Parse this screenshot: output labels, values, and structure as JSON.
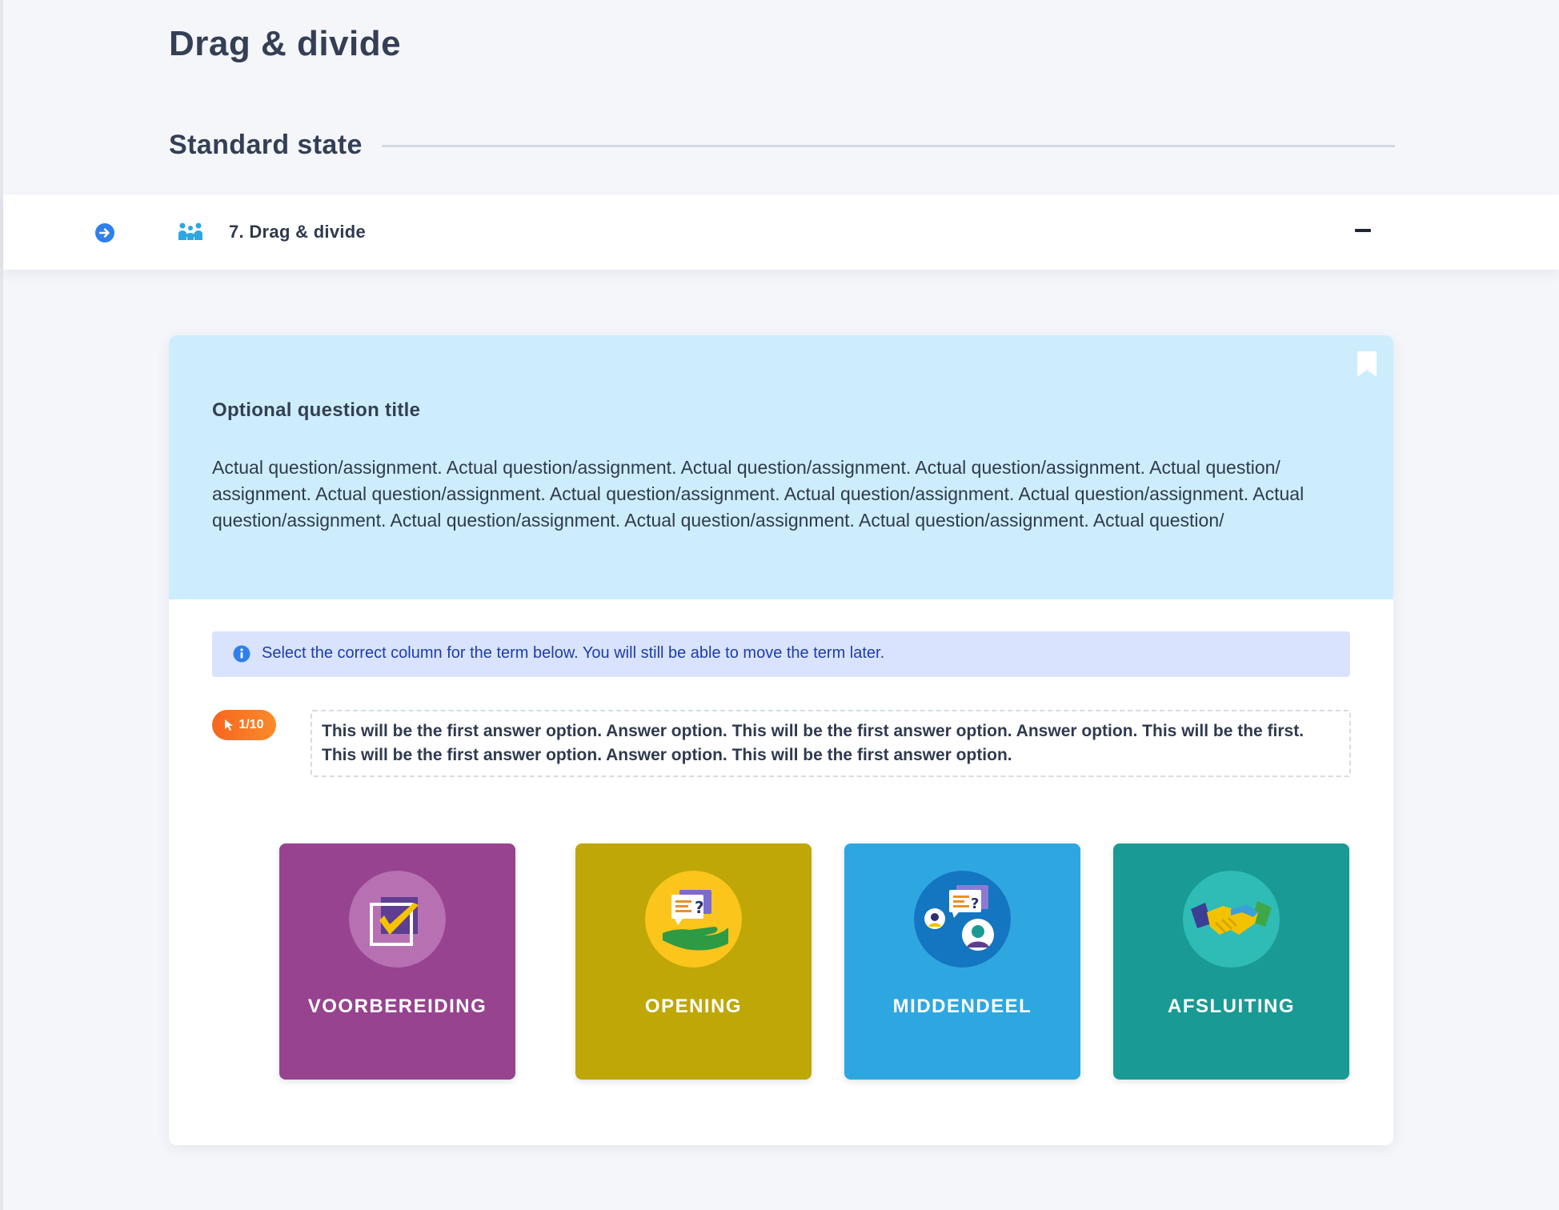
{
  "page": {
    "title": "Drag & divide",
    "section_heading": "Standard state"
  },
  "accordion": {
    "title": "7. Drag & divide",
    "arrow_icon": "arrow-right-circle-icon",
    "type_icon": "people-group-icon",
    "collapse_icon": "minus-icon"
  },
  "question": {
    "title": "Optional question title",
    "body": "Actual question/assignment. Actual question/assignment. Actual question/assignment. Actual question/assignment. Actual question/ assignment. Actual question/assignment. Actual question/assignment. Actual question/assignment. Actual question/assignment. Actual question/assignment. Actual question/assignment. Actual question/assignment. Actual question/assignment. Actual question/",
    "bookmark_icon": "bookmark-icon"
  },
  "info": {
    "text": "Select the correct column for the term below. You will still be able to move the term later.",
    "icon": "info-icon"
  },
  "counter": {
    "label": "1/10",
    "icon": "cursor-pointer-icon"
  },
  "answer": {
    "text": "This will be the first answer option. Answer option. This will be the first answer option. Answer option. This will be the first. This will be the first answer option. Answer option. This will be the first answer option."
  },
  "columns": [
    {
      "label": "VOORBEREIDING",
      "color": "#974390",
      "icon": "checkbox-check-icon"
    },
    {
      "label": "OPENING",
      "color": "#bea706",
      "icon": "hand-speech-bubble-icon"
    },
    {
      "label": "MIDDENDEEL",
      "color": "#2ea7e0",
      "icon": "people-conversation-icon"
    },
    {
      "label": "AFSLUITING",
      "color": "#1a9a94",
      "icon": "handshake-icon"
    }
  ],
  "colors": {
    "background": "#f4f6fa",
    "question_panel": "#cdedfc",
    "info_bar": "#dae3fd",
    "info_text": "#1b3ea8",
    "counter_badge": "#f7661f",
    "accent_blue": "#2f80ed"
  }
}
